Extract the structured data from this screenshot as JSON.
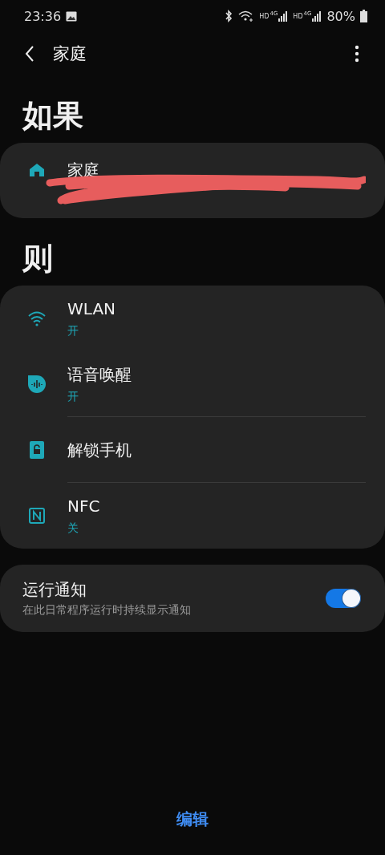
{
  "status_bar": {
    "time": "23:36",
    "battery": "80%",
    "network_labels": [
      {
        "hd": "HD",
        "gen": "4G"
      },
      {
        "hd": "HD",
        "gen": "4G"
      }
    ]
  },
  "header": {
    "title": "家庭"
  },
  "if_section": {
    "heading": "如果",
    "condition": {
      "kind": "home",
      "title": "家庭"
    }
  },
  "then_section": {
    "heading": "则",
    "actions": [
      {
        "kind": "wifi",
        "title": "WLAN",
        "value": "开"
      },
      {
        "kind": "voice",
        "title": "语音唤醒",
        "value": "开"
      },
      {
        "kind": "unlock",
        "title": "解锁手机"
      },
      {
        "kind": "nfc",
        "title": "NFC",
        "value": "关"
      }
    ]
  },
  "notification": {
    "title": "运行通知",
    "description": "在此日常程序运行时持续显示通知",
    "on": true
  },
  "bottom_button": "编辑"
}
